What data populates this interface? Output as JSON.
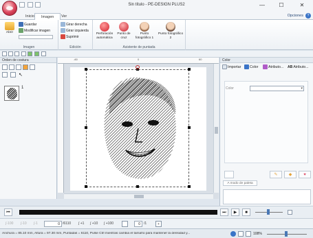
{
  "window": {
    "title": "Sin título - PE-DESIGN PLUS2",
    "minimize": "—",
    "maximize": "☐",
    "close": "✕"
  },
  "tabs": [
    {
      "label": "Inicio"
    },
    {
      "label": "Imagen"
    },
    {
      "label": "Ver"
    }
  ],
  "options_label": "Opciones",
  "help_label": "?",
  "ribbon": {
    "imagen": {
      "abrir": "Abrir",
      "guardar": "Guardar",
      "modificar": "Modificar imagen",
      "group_label": "Imagen"
    },
    "edicion": {
      "girar_derecha": "Girar derecha",
      "girar_izquierda": "Girar izquierda",
      "suprimir": "Suprimir",
      "group_label": "Edición"
    },
    "asistente": {
      "perforacion": "Perforación automática",
      "punto_cruz": "Punto de cruz",
      "foto1": "Punto fotográfico 1",
      "foto2": "Punto fotográfico 2",
      "group_label": "Asistente de puntada"
    }
  },
  "left_panel": {
    "title": "Orden de costura",
    "item_number": "1"
  },
  "ruler": {
    "h_ticks": [
      "-60",
      "0",
      "60"
    ]
  },
  "color_panel": {
    "title": "Color",
    "tabs": [
      "Importar",
      "Color",
      "Atributo...",
      "Atributo..."
    ],
    "label_color": "Color",
    "paleta_button": "A modo de paleta"
  },
  "stitch_bar": {
    "field1": "0",
    "total": "/6110",
    "step1": "+1",
    "step10": "+10",
    "step100": "+100",
    "field2": "0",
    "total2": "/1"
  },
  "status": {
    "text": "Anchura = 85.10 mm, Altura = 97.30 mm, Puntadas = 6110, Pulse Ctrl mientras cambia el tamaño para mantener la densidad y...",
    "zoom": "108%"
  },
  "colors": {
    "accent": "#3a74c7",
    "play_track": "#111111"
  }
}
